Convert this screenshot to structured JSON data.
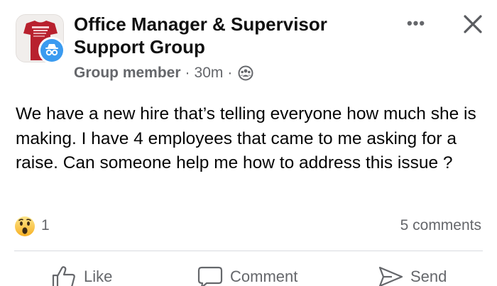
{
  "post": {
    "group_name": "Office Manager & Supervisor Support Group",
    "group_avatar_text": "OFFICE MANAGER",
    "role": "Group member",
    "separator": "·",
    "time": "30m",
    "body": "We have a new hire that’s telling everyone how much she is making. I have 4 employees that came to me asking for a raise. Can someone help me how to address this issue ?",
    "reaction_icon": "wow-emoji-icon",
    "reaction_count": "1",
    "comments": "5 comments"
  },
  "actions": {
    "like_label": "Like",
    "comment_label": "Comment",
    "send_label": "Send"
  },
  "header_controls": {
    "more_label": "•••"
  },
  "colors": {
    "text": "#050505",
    "secondary": "#65676b",
    "badge_blue": "#3b9bf0",
    "avatar_shirt": "#b8212e"
  }
}
